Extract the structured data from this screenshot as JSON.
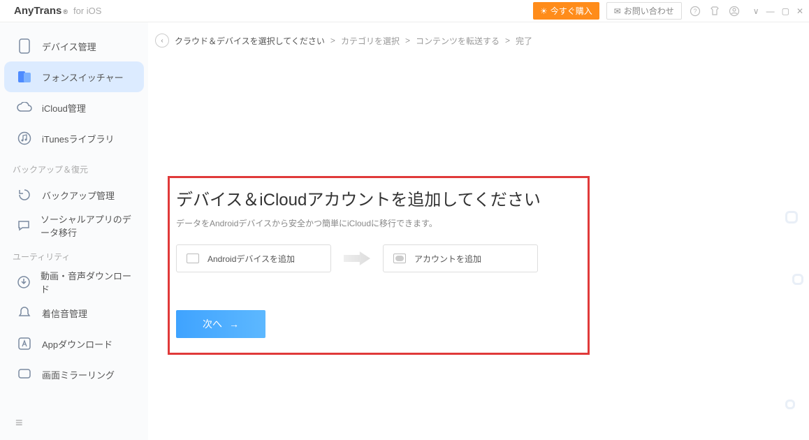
{
  "title": {
    "brand": "AnyTrans",
    "reg": "®",
    "sub": "for iOS"
  },
  "header": {
    "buy": "今すぐ購入",
    "contact": "お問い合わせ"
  },
  "sidebar": {
    "items": [
      {
        "label": "デバイス管理"
      },
      {
        "label": "フォンスイッチャー"
      },
      {
        "label": "iCloud管理"
      },
      {
        "label": "iTunesライブラリ"
      }
    ],
    "section_backup": "バックアップ＆復元",
    "backup_items": [
      {
        "label": "バックアップ管理"
      },
      {
        "label": "ソーシャルアプリのデータ移行"
      }
    ],
    "section_util": "ユーティリティ",
    "util_items": [
      {
        "label": "動画・音声ダウンロード"
      },
      {
        "label": "着信音管理"
      },
      {
        "label": "Appダウンロード"
      },
      {
        "label": "画面ミラーリング"
      }
    ]
  },
  "crumbs": {
    "c1": "クラウド＆デバイスを選択してください",
    "sep": ">",
    "c2": "カテゴリを選択",
    "c3": "コンテンツを転送する",
    "c4": "完了"
  },
  "main": {
    "title": "デバイス＆iCloudアカウントを追加してください",
    "subtitle": "データをAndroidデバイスから安全かつ簡単にiCloudに移行できます。",
    "add_android": "Androidデバイスを追加",
    "add_account": "アカウントを追加",
    "next": "次へ"
  }
}
